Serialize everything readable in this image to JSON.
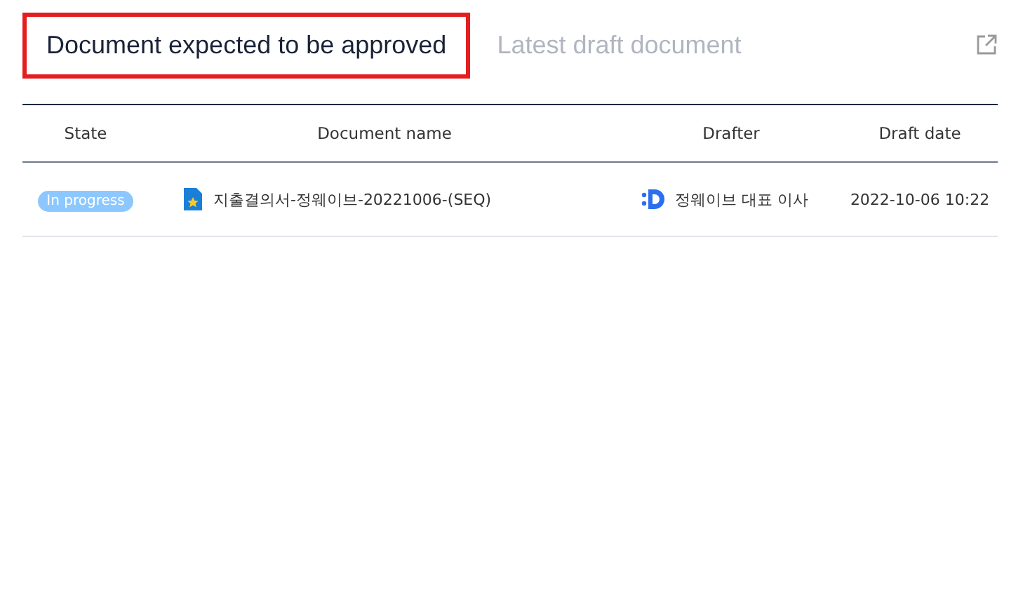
{
  "tabs": [
    {
      "label": "Document expected to be approved",
      "selected": true
    },
    {
      "label": "Latest draft document",
      "selected": false
    }
  ],
  "table": {
    "columns": [
      "State",
      "Document name",
      "Drafter",
      "Draft date"
    ],
    "rows": [
      {
        "state": "In progress",
        "document_name": "지출결의서-정웨이브-20221006-(SEQ)",
        "drafter": "정웨이브 대표 이사",
        "draft_date": "2022-10-06 10:22"
      }
    ]
  }
}
